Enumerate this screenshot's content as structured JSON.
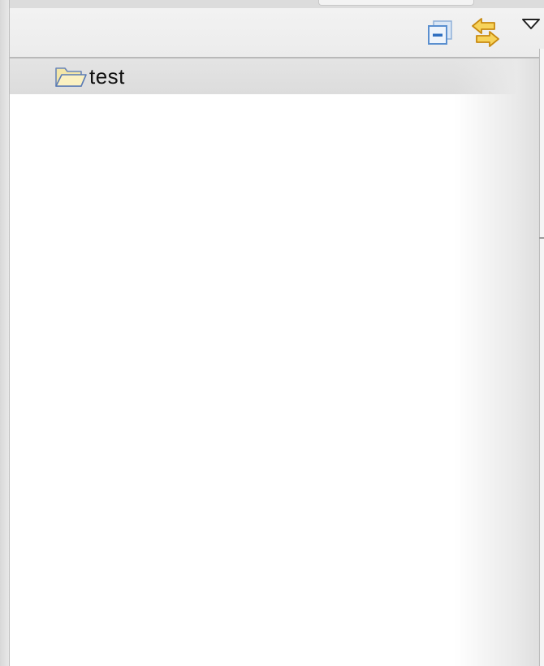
{
  "toolbar": {
    "collapse_all": {
      "icon": "collapse-all-icon",
      "color": "#5a8fcf"
    },
    "link_with_editor": {
      "icon": "link-with-editor-icon",
      "color": "#e8b020"
    },
    "view_menu": {
      "icon": "view-menu-icon"
    }
  },
  "tree": {
    "items": [
      {
        "label": "test",
        "icon": "folder-open-icon",
        "selected": true
      }
    ]
  }
}
